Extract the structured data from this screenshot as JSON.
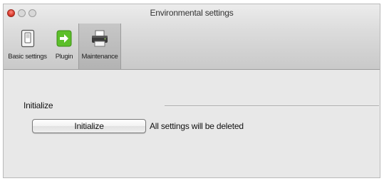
{
  "window": {
    "title": "Environmental settings"
  },
  "toolbar": {
    "items": [
      {
        "label": "Basic settings",
        "icon": "switch-icon",
        "selected": false
      },
      {
        "label": "Plugin",
        "icon": "plugin-arrow-icon",
        "selected": false
      },
      {
        "label": "Maintenance",
        "icon": "printer-icon",
        "selected": true
      }
    ]
  },
  "maintenance": {
    "section_label": "Initialize",
    "button_label": "Initialize",
    "description": "All settings will be deleted"
  },
  "colors": {
    "plugin_green": "#5cbf2a",
    "close_red": "#d93a2c"
  }
}
